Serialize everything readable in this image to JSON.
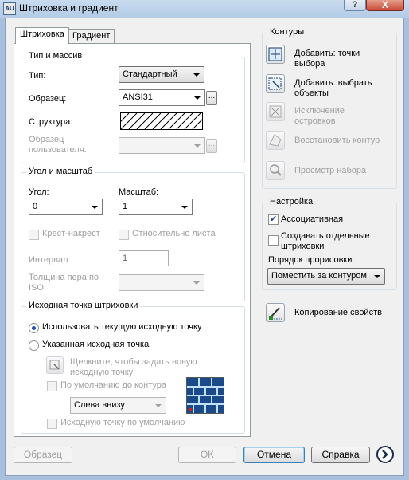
{
  "window": {
    "title": "Штриховка и градиент",
    "app_icon_text": "AU",
    "help_label": "?",
    "close_label": "X"
  },
  "tabs": [
    {
      "label": "Штриховка",
      "active": true
    },
    {
      "label": "Градиент",
      "active": false
    }
  ],
  "type_group": {
    "title": "Тип и массив",
    "type_label": "Тип:",
    "type_value": "Стандартный",
    "pattern_label": "Образец:",
    "pattern_value": "ANSI31",
    "swatch_label": "Структура:",
    "custom_label": "Образец пользователя:",
    "custom_value": "",
    "dots": "..."
  },
  "angle_group": {
    "title": "Угол и масштаб",
    "angle_label": "Угол:",
    "angle_value": "0",
    "scale_label": "Масштаб:",
    "scale_value": "1",
    "double_label": "Крест-накрест",
    "relative_label": "Относительно листа",
    "spacing_label": "Интервал:",
    "spacing_value": "1",
    "iso_label": "Толщина пера по ISO:"
  },
  "origin_group": {
    "title": "Исходная точка штриховки",
    "use_current_label": "Использовать текущую исходную точку",
    "specified_label": "Указанная исходная точка",
    "click_to_set_label": "Щелкните, чтобы задать новую исходную точку",
    "default_to_boundary_label": "По умолчанию до контура",
    "position_value": "Слева внизу",
    "store_default_label": "Исходную точку по умолчанию"
  },
  "boundaries": {
    "title": "Контуры",
    "add_pick_points": "Добавить: точки выбора",
    "add_select_objects": "Добавить: выбрать объекты",
    "remove_islands": "Исключение островков",
    "recreate_boundary": "Восстановить контур",
    "view_selections": "Просмотр набора"
  },
  "options": {
    "title": "Настройка",
    "associative_label": "Ассоциативная",
    "associative_checked": true,
    "separate_label": "Создавать отдельные штриховки",
    "separate_checked": false,
    "draw_order_label": "Порядок прорисовки:",
    "draw_order_value": "Поместить за контуром"
  },
  "inherit_properties": "Копирование свойств",
  "footer": {
    "preview": "Образец",
    "ok": "OK",
    "cancel": "Отмена",
    "help": "Справка"
  }
}
